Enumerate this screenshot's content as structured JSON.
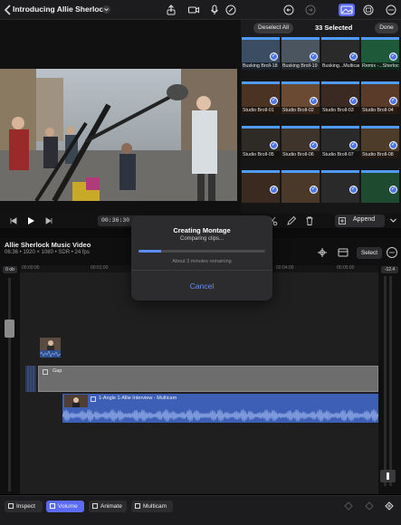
{
  "header": {
    "title": "Introducing Allie Sherlock",
    "icons": [
      "share-icon",
      "camera-icon",
      "microphone-icon",
      "pen-icon",
      "undo-icon",
      "redo-icon",
      "photo-browser-icon",
      "media-browser-icon",
      "more-icon"
    ]
  },
  "browser": {
    "deselect_label": "Deselect All",
    "selected_count": "33 Selected",
    "done_label": "Done",
    "clips": [
      {
        "label": "Busking Broll-18",
        "color": "#3a4d62"
      },
      {
        "label": "Busking Broll-19",
        "color": "#4a5560"
      },
      {
        "label": "Busking...Multicam",
        "color": "#2a2a2a"
      },
      {
        "label": "Remix -...Sherlock",
        "color": "#1e5a3a"
      },
      {
        "label": "Studio Broll-01",
        "color": "#4a3322"
      },
      {
        "label": "Studio Broll-02",
        "color": "#6b4a33"
      },
      {
        "label": "Studio Broll-03",
        "color": "#3a2a22"
      },
      {
        "label": "Studio Broll-04",
        "color": "#5a3a28"
      },
      {
        "label": "Studio Broll-05",
        "color": "#2e2a26"
      },
      {
        "label": "Studio Broll-06",
        "color": "#3e342c"
      },
      {
        "label": "Studio Broll-07",
        "color": "#2a2a2a"
      },
      {
        "label": "Studio Broll-08",
        "color": "#4e3c2a"
      },
      {
        "label": "",
        "color": "#3a2a20"
      },
      {
        "label": "",
        "color": "#4a3828"
      },
      {
        "label": "",
        "color": "#2a2a2a"
      },
      {
        "label": "",
        "color": "#1e4a30"
      }
    ]
  },
  "transport": {
    "timecode": "00:36:30",
    "append_label": "Append"
  },
  "timeline": {
    "title": "Allie Sherlock Music Video",
    "meta": "06:36 • 1920 × 1080 • SDR • 24 fps",
    "ruler_ticks": [
      "00:00:00",
      "00:01:00",
      "00:02:00",
      "00:04:00",
      "00:05:00"
    ],
    "select_label": "Select",
    "left_label": "0 ob",
    "right_label": "-12.4",
    "gap_label": "Gap",
    "clip_label": "1-Angle 1-Allie Interview - Multicam"
  },
  "dialog": {
    "title": "Creating Montage",
    "subtitle": "Comparing clips...",
    "progress": 0.18,
    "remaining": "About 3 minutes remaining",
    "cancel_label": "Cancel"
  },
  "bottombar": {
    "inspect_label": "Inspect",
    "volume_label": "Volume",
    "animate_label": "Animate",
    "multicam_label": "Multicam"
  },
  "colors": {
    "accent": "#5b6bf5",
    "selection_blue": "#4f9bf7",
    "audio_blue": "#3d5fb5",
    "gap_gray": "#6d6d6d"
  }
}
